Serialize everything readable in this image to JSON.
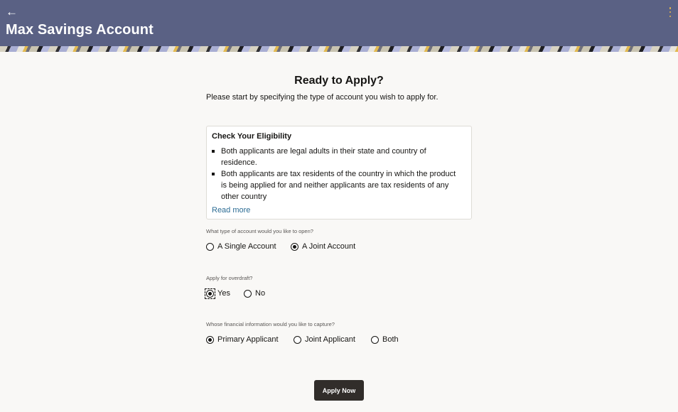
{
  "header": {
    "back_icon": "arrow-left-icon",
    "title": "Max Savings Account",
    "menu_icon": "kebab-menu-icon",
    "accent_color": "#e6b84a",
    "background_color": "#5a6184"
  },
  "main": {
    "heading": "Ready to Apply?",
    "subheading": "Please start by specifying the type of account you wish to apply for."
  },
  "eligibility": {
    "title": "Check Your Eligibility",
    "items": [
      "Both applicants are legal adults in their state and country of residence.",
      "Both applicants are tax residents of the country in which the product is being applied for and neither applicants are tax residents of any other country"
    ],
    "read_more": "Read more"
  },
  "questions": {
    "account_type": {
      "label": "What type of account would you like to open?",
      "options": [
        "A Single Account",
        "A Joint Account"
      ],
      "selected": "A Joint Account"
    },
    "overdraft": {
      "label": "Apply for overdraft?",
      "options": [
        "Yes",
        "No"
      ],
      "selected": "Yes"
    },
    "financial_info": {
      "label": "Whose financial information would you like to capture?",
      "options": [
        "Primary Applicant",
        "Joint Applicant",
        "Both"
      ],
      "selected": "Primary Applicant"
    }
  },
  "actions": {
    "apply_label": "Apply Now"
  }
}
